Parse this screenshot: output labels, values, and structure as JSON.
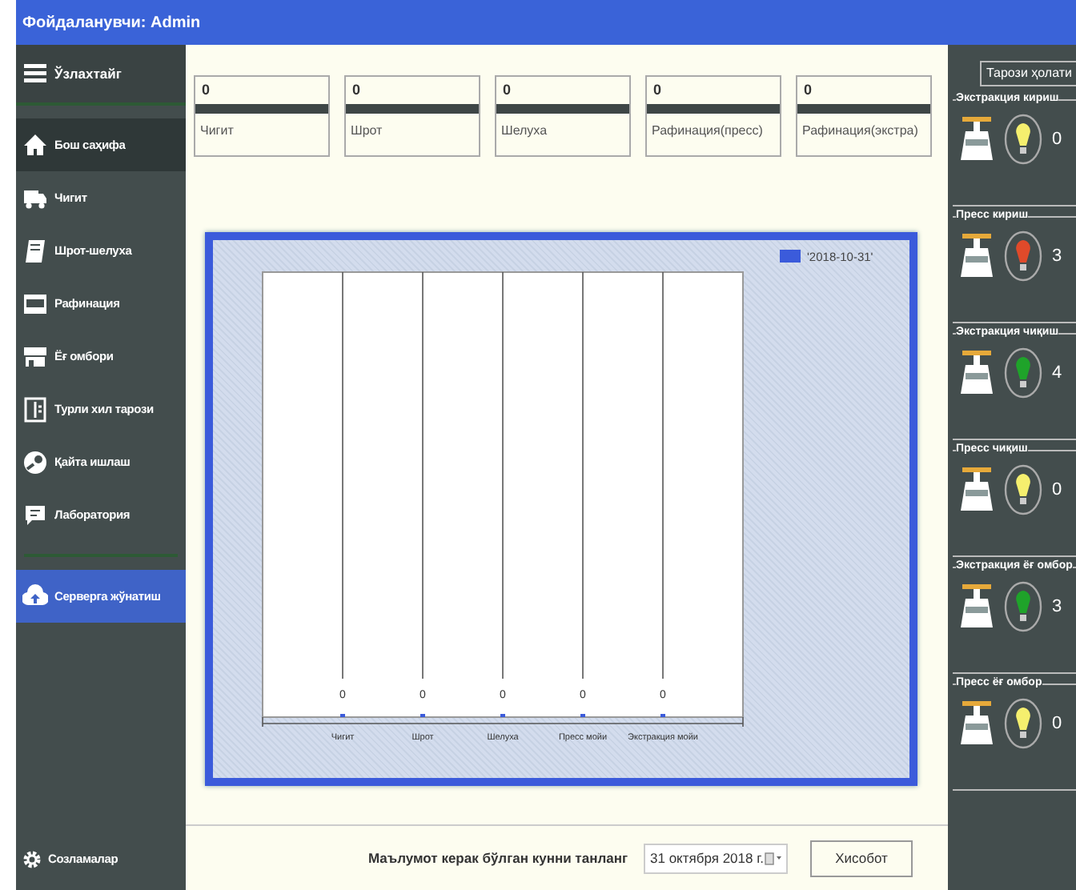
{
  "window": {
    "title": "Фойдаланувчи: Admin"
  },
  "sidebar": {
    "header": "Ўзлахтайг",
    "items": [
      {
        "label": "Бош саҳифа",
        "selected": true
      },
      {
        "label": "Чигит",
        "selected": false
      },
      {
        "label": "Шрот-шелуха",
        "selected": false
      },
      {
        "label": "Рафинация",
        "selected": false
      },
      {
        "label": "Ёғ омбори",
        "selected": false
      },
      {
        "label": "Турли хил тарози",
        "selected": false
      },
      {
        "label": "Қайта ишлаш",
        "selected": false
      },
      {
        "label": "Лаборатория",
        "selected": false
      }
    ],
    "send": {
      "label": "Серверга жўнатиш"
    },
    "settings": {
      "label": "Созламалар"
    }
  },
  "tiles": [
    {
      "value": "0",
      "label": "Чигит"
    },
    {
      "value": "0",
      "label": "Шрот"
    },
    {
      "value": "0",
      "label": "Шелуха"
    },
    {
      "value": "0",
      "label": "Рафинация(пресс)"
    },
    {
      "value": "0",
      "label": "Рафинация(экстра)"
    }
  ],
  "chart": {
    "legend": "'2018-10-31'",
    "columns": [
      {
        "category": "Чигит",
        "value_label": "0"
      },
      {
        "category": "Шрот",
        "value_label": "0"
      },
      {
        "category": "Шелуха",
        "value_label": "0"
      },
      {
        "category": "Пресс мойи",
        "value_label": "0"
      },
      {
        "category": "Экстракция мойи",
        "value_label": "0"
      }
    ]
  },
  "footer": {
    "prompt": "Маълумот керак бўлган кунни танланг",
    "date": "31  октября  2018 г.",
    "button": "Хисобот"
  },
  "scales": {
    "title": "Тарози ҳолати",
    "items": [
      {
        "label": "Экстракция кириш",
        "color": "#f5ef6e",
        "value": "0"
      },
      {
        "label": "Пресс кириш",
        "color": "#e04a2a",
        "value": "3"
      },
      {
        "label": "Экстракция чиқиш",
        "color": "#1fa32a",
        "value": "4"
      },
      {
        "label": "Пресс чиқиш",
        "color": "#f5ef6e",
        "value": "0"
      },
      {
        "label": "Экстракция ёғ омбор",
        "color": "#1fa32a",
        "value": "3"
      },
      {
        "label": "Пресс ёғ омбор",
        "color": "#f5ef6e",
        "value": "0"
      }
    ]
  }
}
